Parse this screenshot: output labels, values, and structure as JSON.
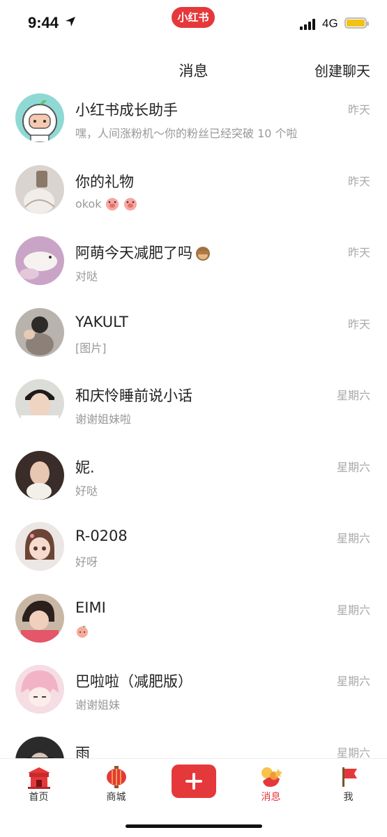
{
  "status_bar": {
    "time": "9:44",
    "network": "4G",
    "app_badge": "小红书"
  },
  "header": {
    "title": "消息",
    "create_chat": "创建聊天"
  },
  "conversations": [
    {
      "name": "小红书成长助手",
      "preview": "嘿，人间涨粉机～你的粉丝已经突破 10 个啦",
      "time": "昨天"
    },
    {
      "name": "你的礼物",
      "preview": "okok",
      "time": "昨天"
    },
    {
      "name": "阿萌今天减肥了吗",
      "preview": "对哒",
      "time": "昨天"
    },
    {
      "name": "YAKULT",
      "preview": "[图片]",
      "time": "昨天"
    },
    {
      "name": "和庆怜睡前说小话",
      "preview": "谢谢姐妹啦",
      "time": "星期六"
    },
    {
      "name": "妮.",
      "preview": "好哒",
      "time": "星期六"
    },
    {
      "name": "R-0208",
      "preview": "好呀",
      "time": "星期六"
    },
    {
      "name": "EIMI",
      "preview": "",
      "time": "星期六"
    },
    {
      "name": "巴啦啦（减肥版）",
      "preview": "谢谢姐妹",
      "time": "星期六"
    },
    {
      "name": "雨",
      "preview": "",
      "time": "星期六"
    }
  ],
  "tabs": [
    {
      "label": "首页"
    },
    {
      "label": "商城"
    },
    {
      "label": ""
    },
    {
      "label": "消息"
    },
    {
      "label": "我"
    }
  ],
  "colors": {
    "accent": "#e5383b",
    "secondary_text": "#999999"
  }
}
